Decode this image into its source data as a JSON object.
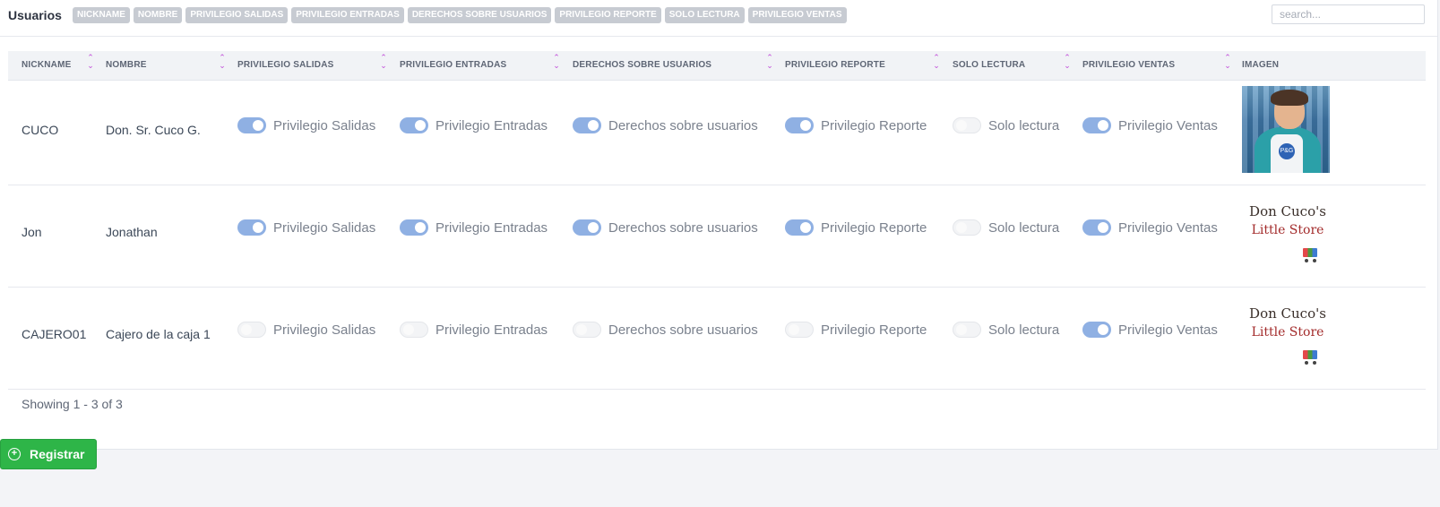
{
  "header": {
    "title": "Usuarios",
    "chips": [
      "NICKNAME",
      "NOMBRE",
      "PRIVILEGIO SALIDAS",
      "PRIVILEGIO ENTRADAS",
      "DERECHOS SOBRE USUARIOS",
      "PRIVILEGIO REPORTE",
      "SOLO LECTURA",
      "PRIVILEGIO VENTAS"
    ],
    "search_placeholder": "search..."
  },
  "table": {
    "columns": [
      "NICKNAME",
      "NOMBRE",
      "PRIVILEGIO SALIDAS",
      "PRIVILEGIO ENTRADAS",
      "DERECHOS SOBRE USUARIOS",
      "PRIVILEGIO REPORTE",
      "SOLO LECTURA",
      "PRIVILEGIO VENTAS",
      "IMAGEN"
    ],
    "sort_icon": "sort-up-down-icon",
    "toggle_labels": [
      "Privilegio Salidas",
      "Privilegio Entradas",
      "Derechos sobre usuarios",
      "Privilegio Reporte",
      "Solo lectura",
      "Privilegio Ventas"
    ],
    "rows": [
      {
        "nickname": "CUCO",
        "nombre": "Don. Sr. Cuco G.",
        "toggles": [
          true,
          true,
          true,
          true,
          false,
          true
        ],
        "image": "photo",
        "image_text": "P&G"
      },
      {
        "nickname": "Jon",
        "nombre": "Jonathan",
        "toggles": [
          true,
          true,
          true,
          true,
          false,
          true
        ],
        "image": "logo",
        "logo_line1": "Don Cuco's",
        "logo_line2": "Little Store"
      },
      {
        "nickname": "CAJERO01",
        "nombre": "Cajero de la caja 1",
        "toggles": [
          false,
          false,
          false,
          false,
          false,
          true
        ],
        "image": "logo",
        "logo_line1": "Don Cuco's",
        "logo_line2": "Little Store"
      }
    ],
    "footer": "Showing 1 - 3 of 3"
  },
  "actions": {
    "register_label": "Registrar",
    "register_icon": "plus-circle-icon"
  },
  "colors": {
    "toggle_on": "#8fb0e3",
    "button": "#2eb548",
    "sort_icon": "#c049d8"
  }
}
